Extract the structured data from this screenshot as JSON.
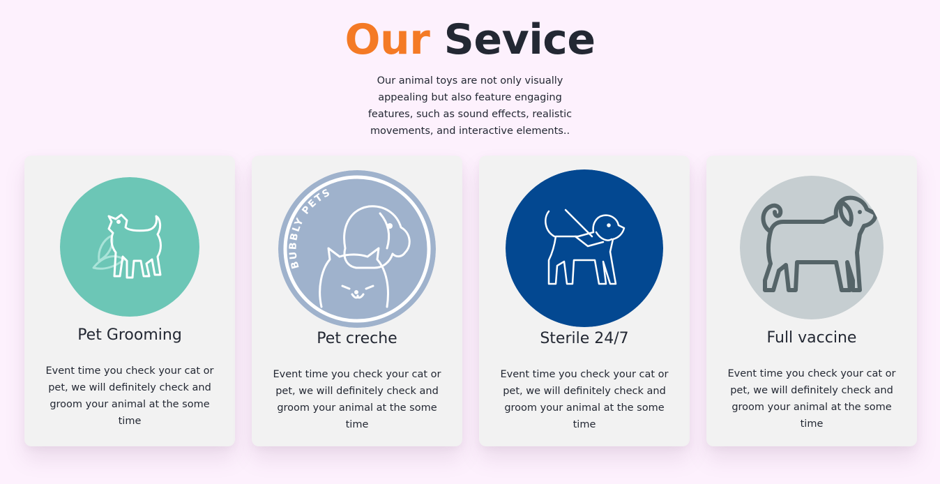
{
  "header": {
    "title_accent": "Our",
    "title_rest": "Sevice",
    "description": "Our animal toys are not only visually appealing but also feature engaging features, such as sound effects, realistic movements, and interactive elements.."
  },
  "colors": {
    "accent": "#f47a25",
    "text": "#232833",
    "page_background": "#fdf1fd",
    "card_background": "#f2f2f2"
  },
  "services": [
    {
      "title": "Pet Grooming",
      "description": "Event time you check your cat or pet, we will definitely check and groom your animal at the some time",
      "icon": "dog-leaf-icon",
      "icon_color": "#6cc6b6"
    },
    {
      "title": "Pet creche",
      "description": "Event time you check your cat or pet, we will definitely check and groom your animal at the some time",
      "icon": "bubbly-pets-logo",
      "icon_color": "#9fb2cc",
      "logo_text": "BUBBLY PETS"
    },
    {
      "title": "Sterile 24/7",
      "description": "Event time you check your cat or pet, we will definitely check and groom your animal at the some time",
      "icon": "guide-dog-icon",
      "icon_color": "#034891"
    },
    {
      "title": "Full vaccine",
      "description": "Event time you check your cat or pet, we will definitely check and groom your animal at the some time",
      "icon": "dog-outline-icon",
      "icon_color": "#c6ced1"
    }
  ]
}
